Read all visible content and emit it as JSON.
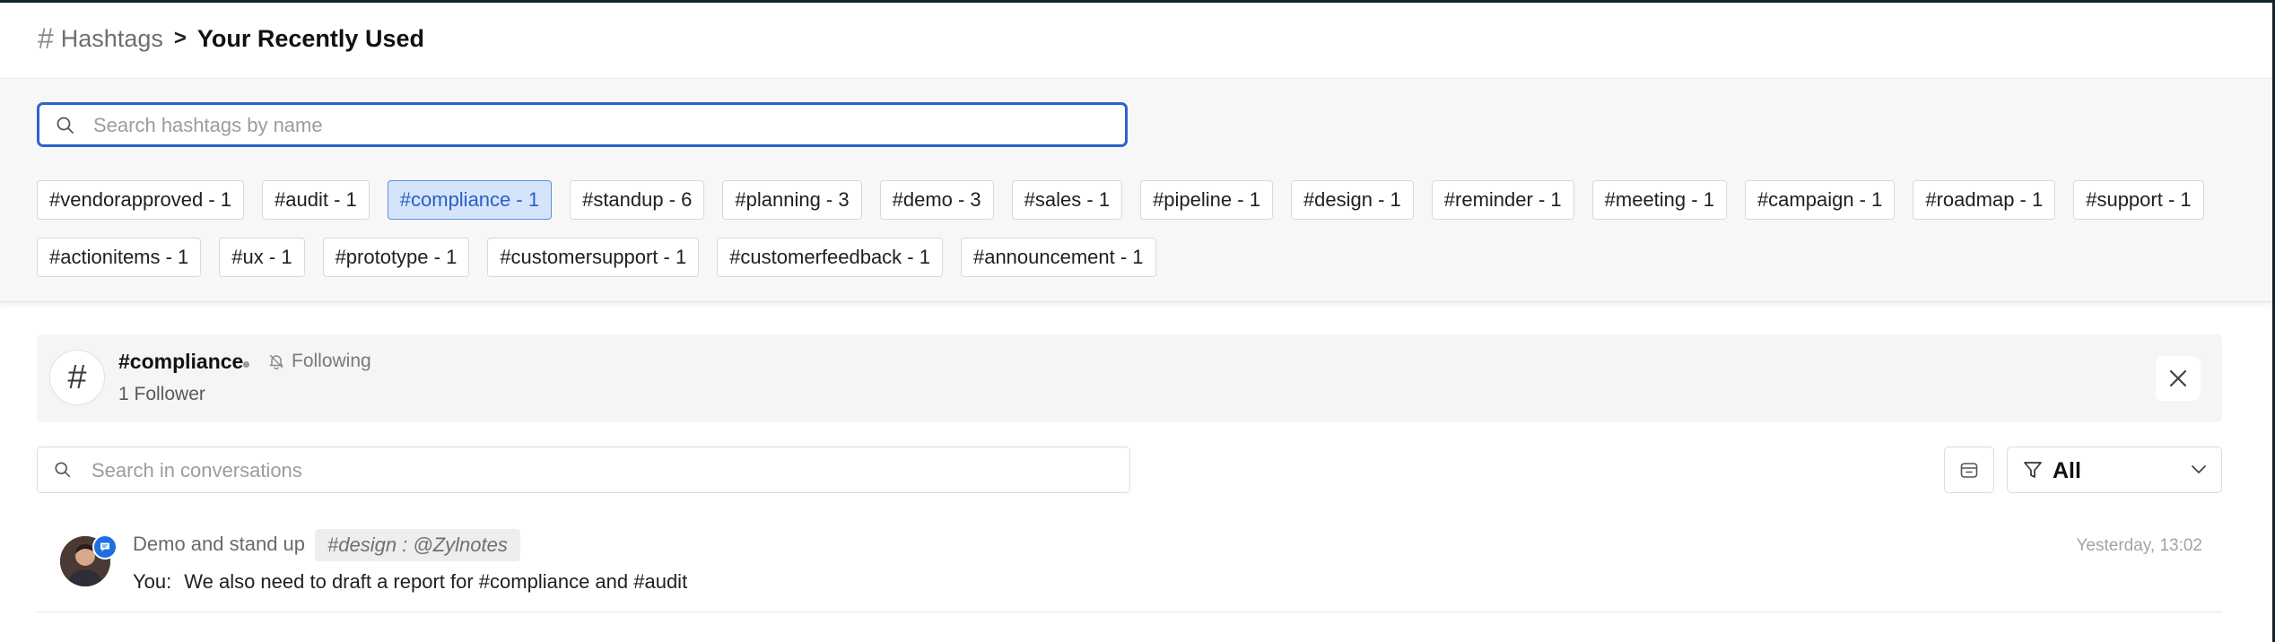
{
  "breadcrumb": {
    "icon": "hash-icon",
    "parent": "Hashtags",
    "separator": ">",
    "current": "Your Recently Used"
  },
  "hashtag_search": {
    "placeholder": "Search hashtags by name",
    "value": ""
  },
  "hashtag_chips": {
    "row1": [
      "#vendorapproved - 1",
      "#audit - 1",
      "#compliance - 1",
      "#standup - 6",
      "#planning - 3",
      "#demo - 3",
      "#sales - 1",
      "#pipeline - 1",
      "#design - 1",
      "#reminder - 1",
      "#meeting - 1",
      "#campaign - 1",
      "#roadmap - 1",
      "#support - 1"
    ],
    "row2": [
      "#actionitems - 1",
      "#ux - 1",
      "#prototype - 1",
      "#customersupport - 1",
      "#customerfeedback - 1",
      "#announcement - 1"
    ],
    "selected": "#compliance - 1"
  },
  "selected_tag": {
    "name": "#compliance",
    "follow_status": "Following",
    "followers": "1 Follower"
  },
  "conversation_search": {
    "placeholder": "Search in conversations",
    "value": ""
  },
  "filter": {
    "label": "All"
  },
  "messages": [
    {
      "title": "Demo and stand up",
      "tag": "#design : @Zylnotes",
      "timestamp": "Yesterday, 13:02",
      "sender": "You:",
      "text": "We also need to draft a report for #compliance and #audit"
    }
  ],
  "colors": {
    "accent": "#2b63cf",
    "selected_chip_bg": "#d5e4fb",
    "badge_blue": "#1d6fe0",
    "panel_bg": "#f7f7f7"
  }
}
